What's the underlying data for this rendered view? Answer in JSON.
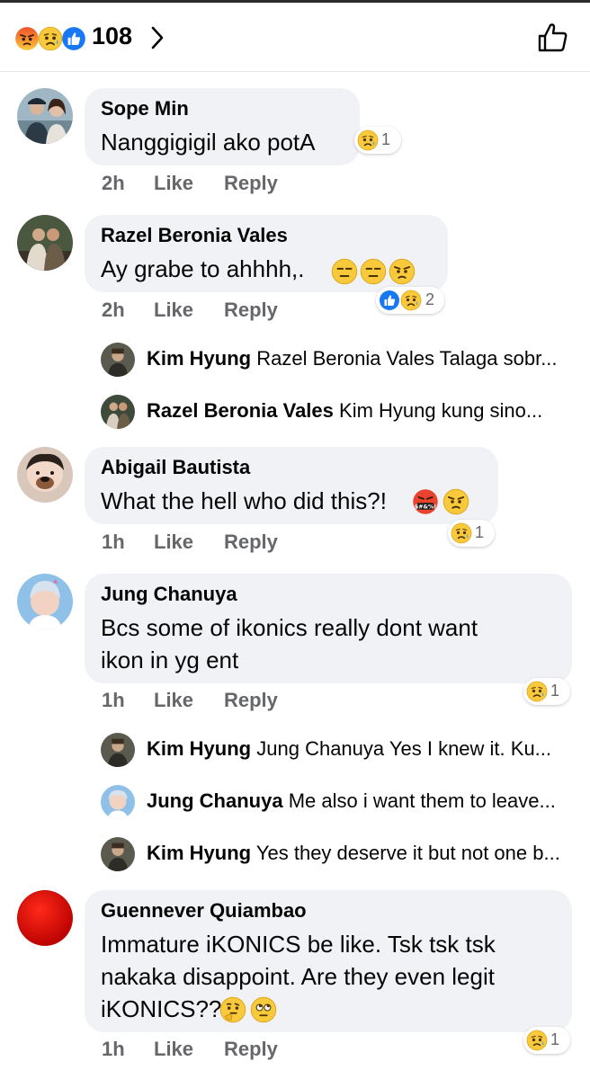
{
  "header": {
    "reaction_count": "108",
    "reactions": [
      "angry",
      "sad",
      "like"
    ]
  },
  "comments": [
    {
      "name": "Sope Min",
      "lines": [
        "Nanggigigil ako potA"
      ],
      "time": "2h",
      "like": "Like",
      "reply": "Reply",
      "reaction_count": "1"
    },
    {
      "name": "Razel Beronia Vales",
      "lines": [
        "Ay grabe to ahhhh,."
      ],
      "time": "2h",
      "like": "Like",
      "reply": "Reply",
      "reaction_count": "2"
    },
    {
      "name": "Abigail Bautista",
      "lines": [
        "What the hell who did this?!"
      ],
      "time": "1h",
      "like": "Like",
      "reply": "Reply",
      "reaction_count": "1"
    },
    {
      "name": "Jung Chanuya",
      "lines": [
        "Bcs some of ikonics really dont want",
        "ikon in yg ent"
      ],
      "time": "1h",
      "like": "Like",
      "reply": "Reply",
      "reaction_count": "1"
    },
    {
      "name": "Guennever Quiambao",
      "lines": [
        "Immature iKONICS be like. Tsk tsk tsk",
        "nakaka disappoint. Are they even legit",
        "iKONICS??"
      ],
      "time": "1h",
      "like": "Like",
      "reply": "Reply",
      "reaction_count": "1"
    }
  ],
  "replies": [
    {
      "name": "Kim Hyung",
      "text": "Razel Beronia Vales Talaga sobr..."
    },
    {
      "name": "Razel Beronia Vales",
      "text": "Kim Hyung kung sino..."
    },
    {
      "name": "Kim Hyung",
      "text": "Jung Chanuya Yes I knew it. Ku..."
    },
    {
      "name": "Jung Chanuya",
      "text": "Me also i want them to leave..."
    },
    {
      "name": "Kim Hyung",
      "text": "Yes they deserve it but not one b..."
    }
  ],
  "colors": {
    "like_blue": "#1877f2",
    "angry_top": "#f26a2b",
    "sad_yellow": "#f7c93b",
    "meta_grey": "#65676b",
    "bubble_grey": "#f0f2f5"
  },
  "icons": {
    "chevron": "chevron-right-icon",
    "thumb": "thumbs-up-outline-icon"
  }
}
